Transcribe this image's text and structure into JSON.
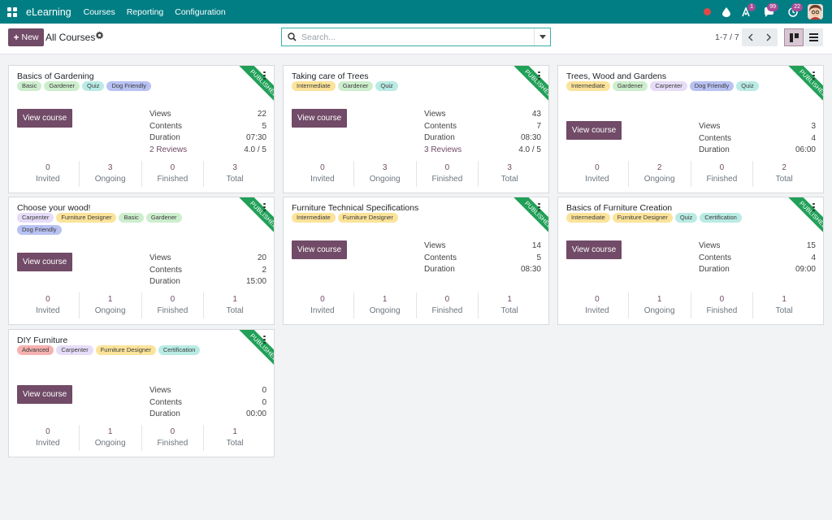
{
  "navbar": {
    "app_name": "eLearning",
    "menus": [
      "Courses",
      "Reporting",
      "Configuration"
    ],
    "badges": {
      "activity": "1",
      "messages": "99",
      "clock": "22"
    }
  },
  "control": {
    "new_label": "New",
    "title": "All Courses",
    "search_placeholder": "Search...",
    "pager": "1-7 / 7"
  },
  "tag_colors": {
    "Basic": "#cdeecd",
    "Gardener": "#cdeecd",
    "Quiz": "#b9ebe4",
    "Dog Friendly": "#b8c2f3",
    "Intermediate": "#fbe39a",
    "Carpenter": "#e6dcf7",
    "Furniture Designer": "#fbe39a",
    "Certification": "#b9ebe4",
    "Advanced": "#f6b1b1"
  },
  "ribbon_label": "PUBLISHED",
  "view_label": "View course",
  "stat_labels": {
    "views": "Views",
    "contents": "Contents",
    "duration": "Duration"
  },
  "footer_labels": [
    "Invited",
    "Ongoing",
    "Finished",
    "Total"
  ],
  "courses": [
    {
      "title": "Basics of Gardening",
      "tags": [
        "Basic",
        "Gardener",
        "Quiz",
        "Dog Friendly"
      ],
      "views": "22",
      "contents": "5",
      "duration": "07:30",
      "reviews": "2 Reviews",
      "rating": "4.0 / 5",
      "invited": "0",
      "ongoing": "3",
      "finished": "0",
      "total": "3"
    },
    {
      "title": "Taking care of Trees",
      "tags": [
        "Intermediate",
        "Gardener",
        "Quiz"
      ],
      "views": "43",
      "contents": "7",
      "duration": "08:30",
      "reviews": "3 Reviews",
      "rating": "4.0 / 5",
      "invited": "0",
      "ongoing": "3",
      "finished": "0",
      "total": "3"
    },
    {
      "title": "Trees, Wood and Gardens",
      "tags": [
        "Intermediate",
        "Gardener",
        "Carpenter",
        "Dog Friendly",
        "Quiz"
      ],
      "views": "3",
      "contents": "4",
      "duration": "06:00",
      "invited": "0",
      "ongoing": "2",
      "finished": "0",
      "total": "2"
    },
    {
      "title": "Choose your wood!",
      "tags": [
        "Carpenter",
        "Furniture Designer",
        "Basic",
        "Gardener",
        "Dog Friendly"
      ],
      "views": "20",
      "contents": "2",
      "duration": "15:00",
      "invited": "0",
      "ongoing": "1",
      "finished": "0",
      "total": "1"
    },
    {
      "title": "Furniture Technical Specifications",
      "tags": [
        "Intermediate",
        "Furniture Designer"
      ],
      "views": "14",
      "contents": "5",
      "duration": "08:30",
      "invited": "0",
      "ongoing": "1",
      "finished": "0",
      "total": "1"
    },
    {
      "title": "Basics of Furniture Creation",
      "tags": [
        "Intermediate",
        "Furniture Designer",
        "Quiz",
        "Certification"
      ],
      "views": "15",
      "contents": "4",
      "duration": "09:00",
      "invited": "0",
      "ongoing": "1",
      "finished": "0",
      "total": "1"
    },
    {
      "title": "DIY Furniture",
      "tags": [
        "Advanced",
        "Carpenter",
        "Furniture Designer",
        "Certification"
      ],
      "views": "0",
      "contents": "0",
      "duration": "00:00",
      "invited": "0",
      "ongoing": "1",
      "finished": "0",
      "total": "1"
    }
  ]
}
